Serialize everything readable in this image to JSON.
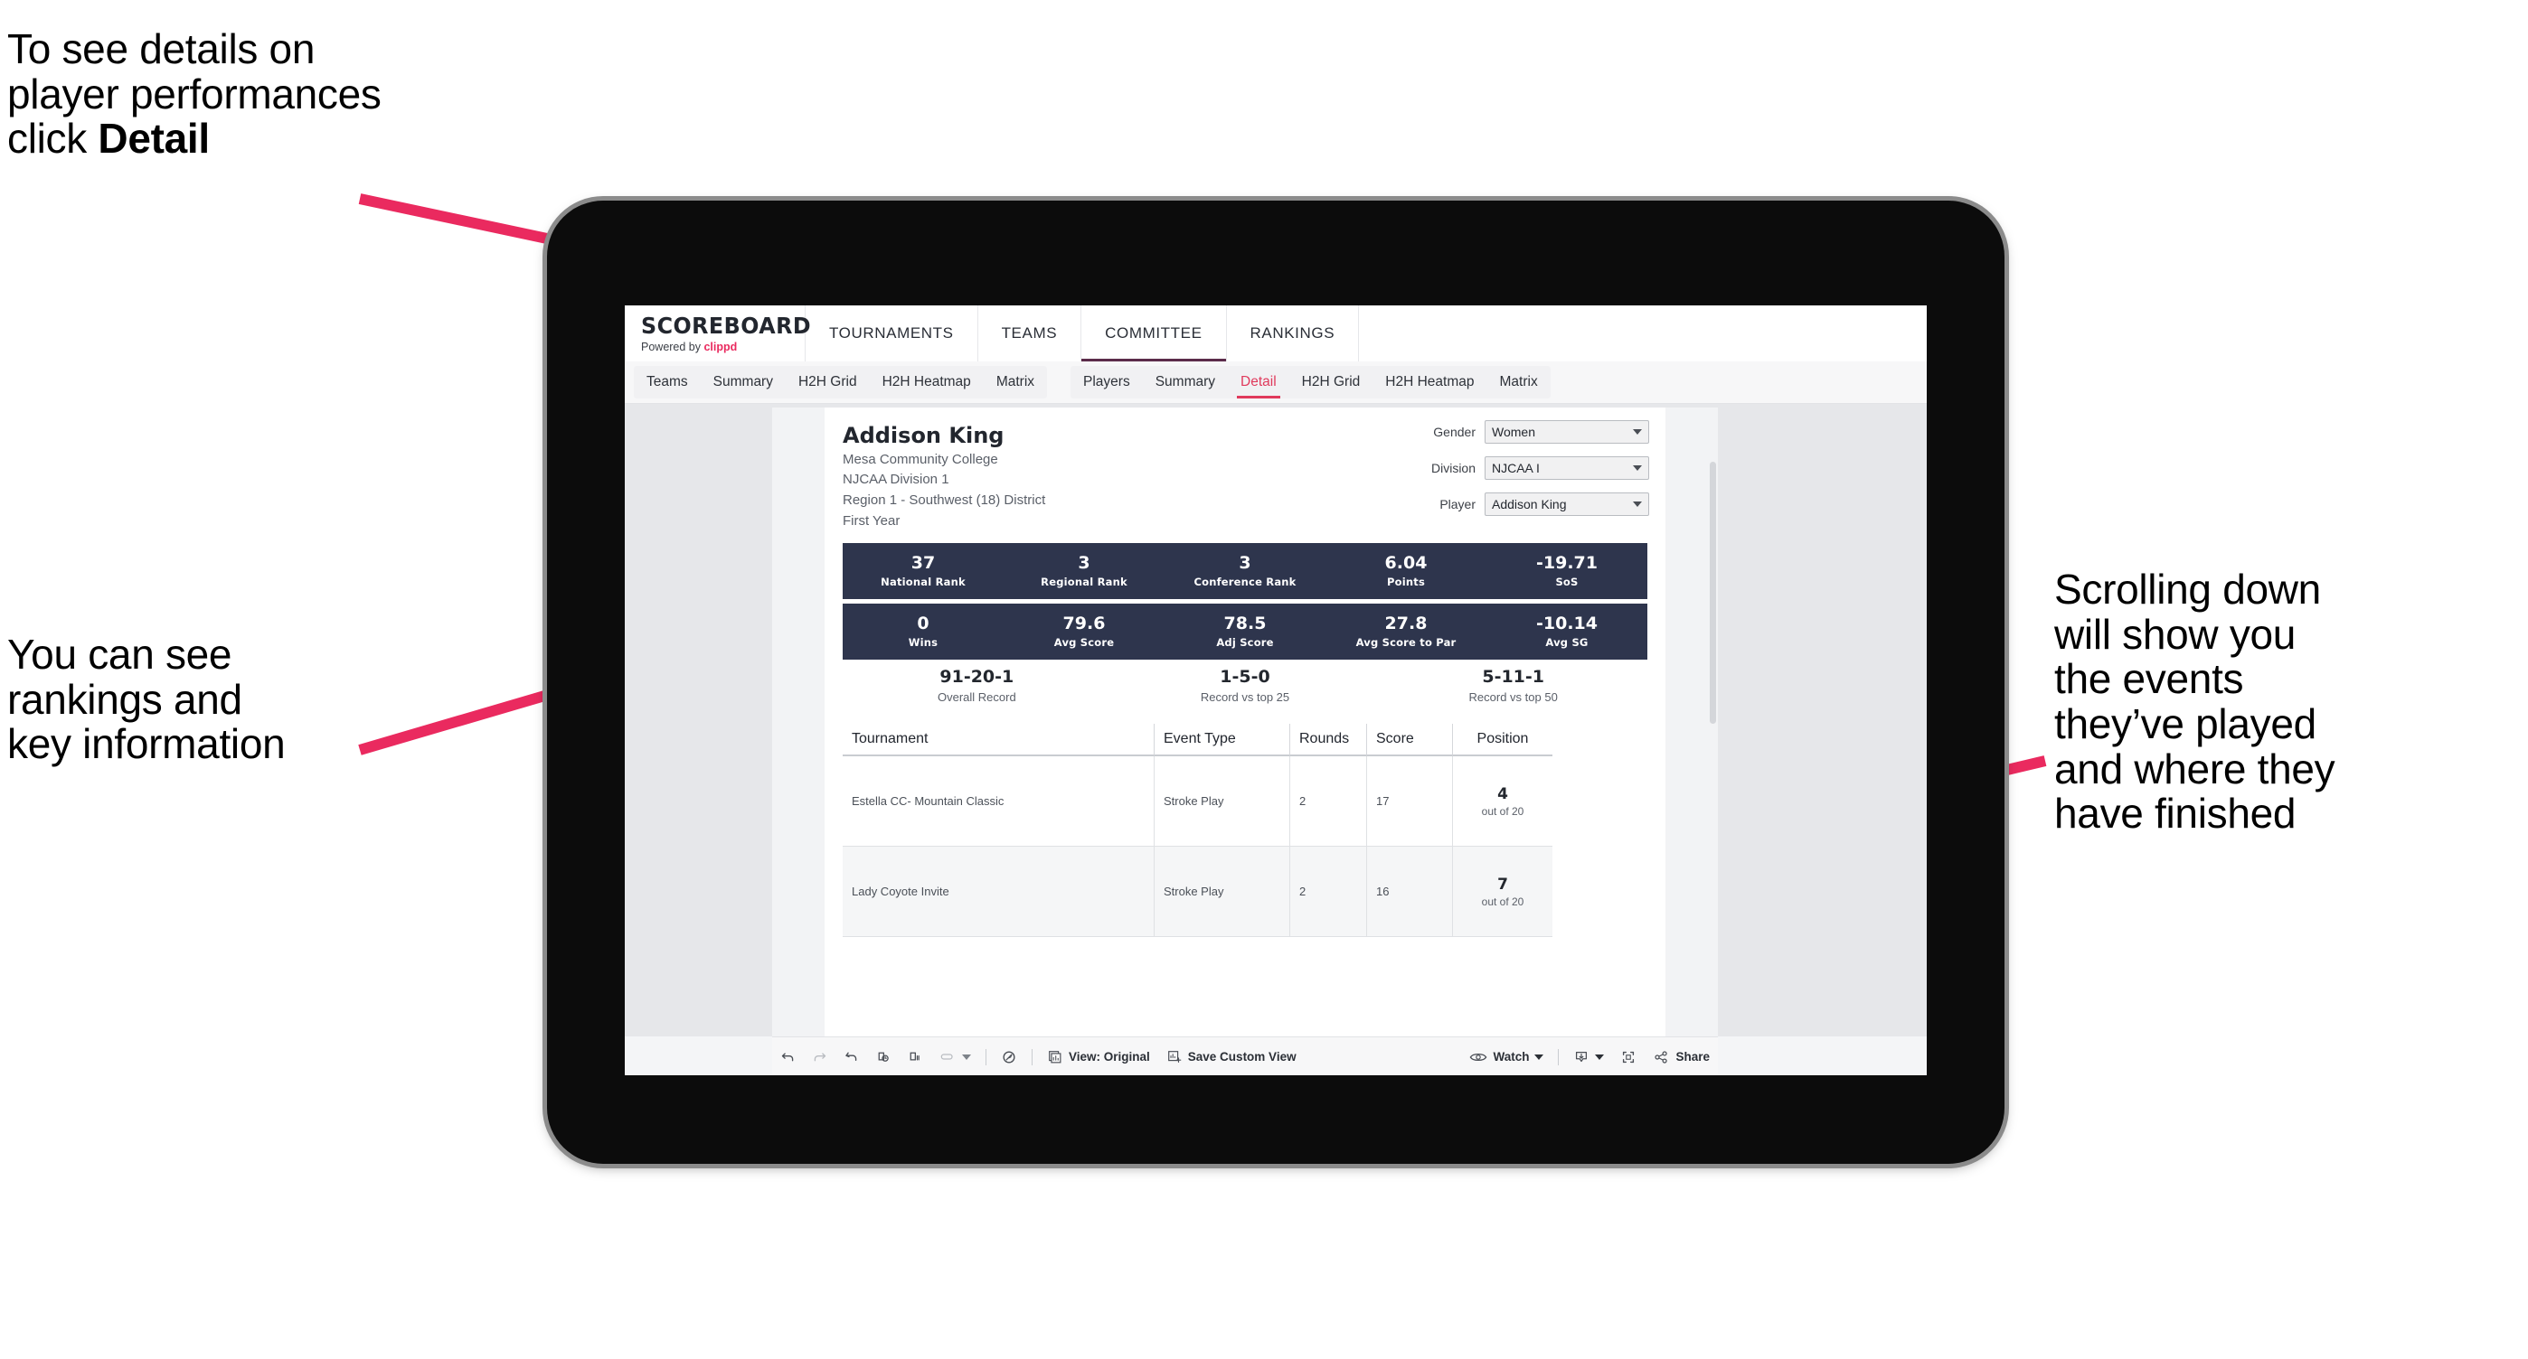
{
  "annotations": {
    "top_left": "To see details on\nplayer performances\nclick ",
    "top_left_bold": "Detail",
    "left": "You can see\nrankings and\nkey information",
    "right": "Scrolling down\nwill show you\nthe events\nthey’ve played\nand where they\nhave finished",
    "arrow_color": "#ea2a5f"
  },
  "app": {
    "brand": {
      "name": "SCOREBOARD",
      "powered_prefix": "Powered by ",
      "powered_name": "clippd"
    },
    "top_nav": [
      {
        "label": "TOURNAMENTS",
        "active": false
      },
      {
        "label": "TEAMS",
        "active": false
      },
      {
        "label": "COMMITTEE",
        "active": true
      },
      {
        "label": "RANKINGS",
        "active": false
      }
    ],
    "tab_group_teams": [
      {
        "label": "Teams",
        "active": false
      },
      {
        "label": "Summary",
        "active": false
      },
      {
        "label": "H2H Grid",
        "active": false
      },
      {
        "label": "H2H Heatmap",
        "active": false
      },
      {
        "label": "Matrix",
        "active": false
      }
    ],
    "tab_group_players": [
      {
        "label": "Players",
        "active": false
      },
      {
        "label": "Summary",
        "active": false
      },
      {
        "label": "Detail",
        "active": true
      },
      {
        "label": "H2H Grid",
        "active": false
      },
      {
        "label": "H2H Heatmap",
        "active": false
      },
      {
        "label": "Matrix",
        "active": false
      }
    ]
  },
  "player": {
    "name": "Addison King",
    "school": "Mesa Community College",
    "division": "NJCAA Division 1",
    "region": "Region 1 - Southwest (18) District",
    "year": "First Year"
  },
  "filters": [
    {
      "label": "Gender",
      "value": "Women"
    },
    {
      "label": "Division",
      "value": "NJCAA I"
    },
    {
      "label": "Player",
      "value": "Addison King"
    }
  ],
  "stats_row1": [
    {
      "value": "37",
      "label": "National Rank"
    },
    {
      "value": "3",
      "label": "Regional Rank"
    },
    {
      "value": "3",
      "label": "Conference Rank"
    },
    {
      "value": "6.04",
      "label": "Points"
    },
    {
      "value": "-19.71",
      "label": "SoS"
    }
  ],
  "stats_row2": [
    {
      "value": "0",
      "label": "Wins"
    },
    {
      "value": "79.6",
      "label": "Avg Score"
    },
    {
      "value": "78.5",
      "label": "Adj Score"
    },
    {
      "value": "27.8",
      "label": "Avg Score to Par"
    },
    {
      "value": "-10.14",
      "label": "Avg SG"
    }
  ],
  "records": [
    {
      "value": "91-20-1",
      "label": "Overall Record"
    },
    {
      "value": "1-5-0",
      "label": "Record vs top 25"
    },
    {
      "value": "5-11-1",
      "label": "Record vs top 50"
    }
  ],
  "table": {
    "headers": [
      "Tournament",
      "Event Type",
      "Rounds",
      "Score",
      "Position"
    ],
    "rows": [
      {
        "tournament": "Estella CC- Mountain Classic",
        "event_type": "Stroke Play",
        "rounds": "2",
        "score": "17",
        "position_num": "4",
        "position_of": "out of 20"
      },
      {
        "tournament": "Lady Coyote Invite",
        "event_type": "Stroke Play",
        "rounds": "2",
        "score": "16",
        "position_num": "7",
        "position_of": "out of 20"
      }
    ]
  },
  "toolbar": {
    "view_label": "View: Original",
    "save_label": "Save Custom View",
    "watch_label": "Watch",
    "share_label": "Share"
  },
  "colors": {
    "accent_pink": "#ea2a5f",
    "tab_active": "#e03a5c",
    "stat_bar": "#2e354d",
    "tablet_body": "#0c0c0c"
  }
}
